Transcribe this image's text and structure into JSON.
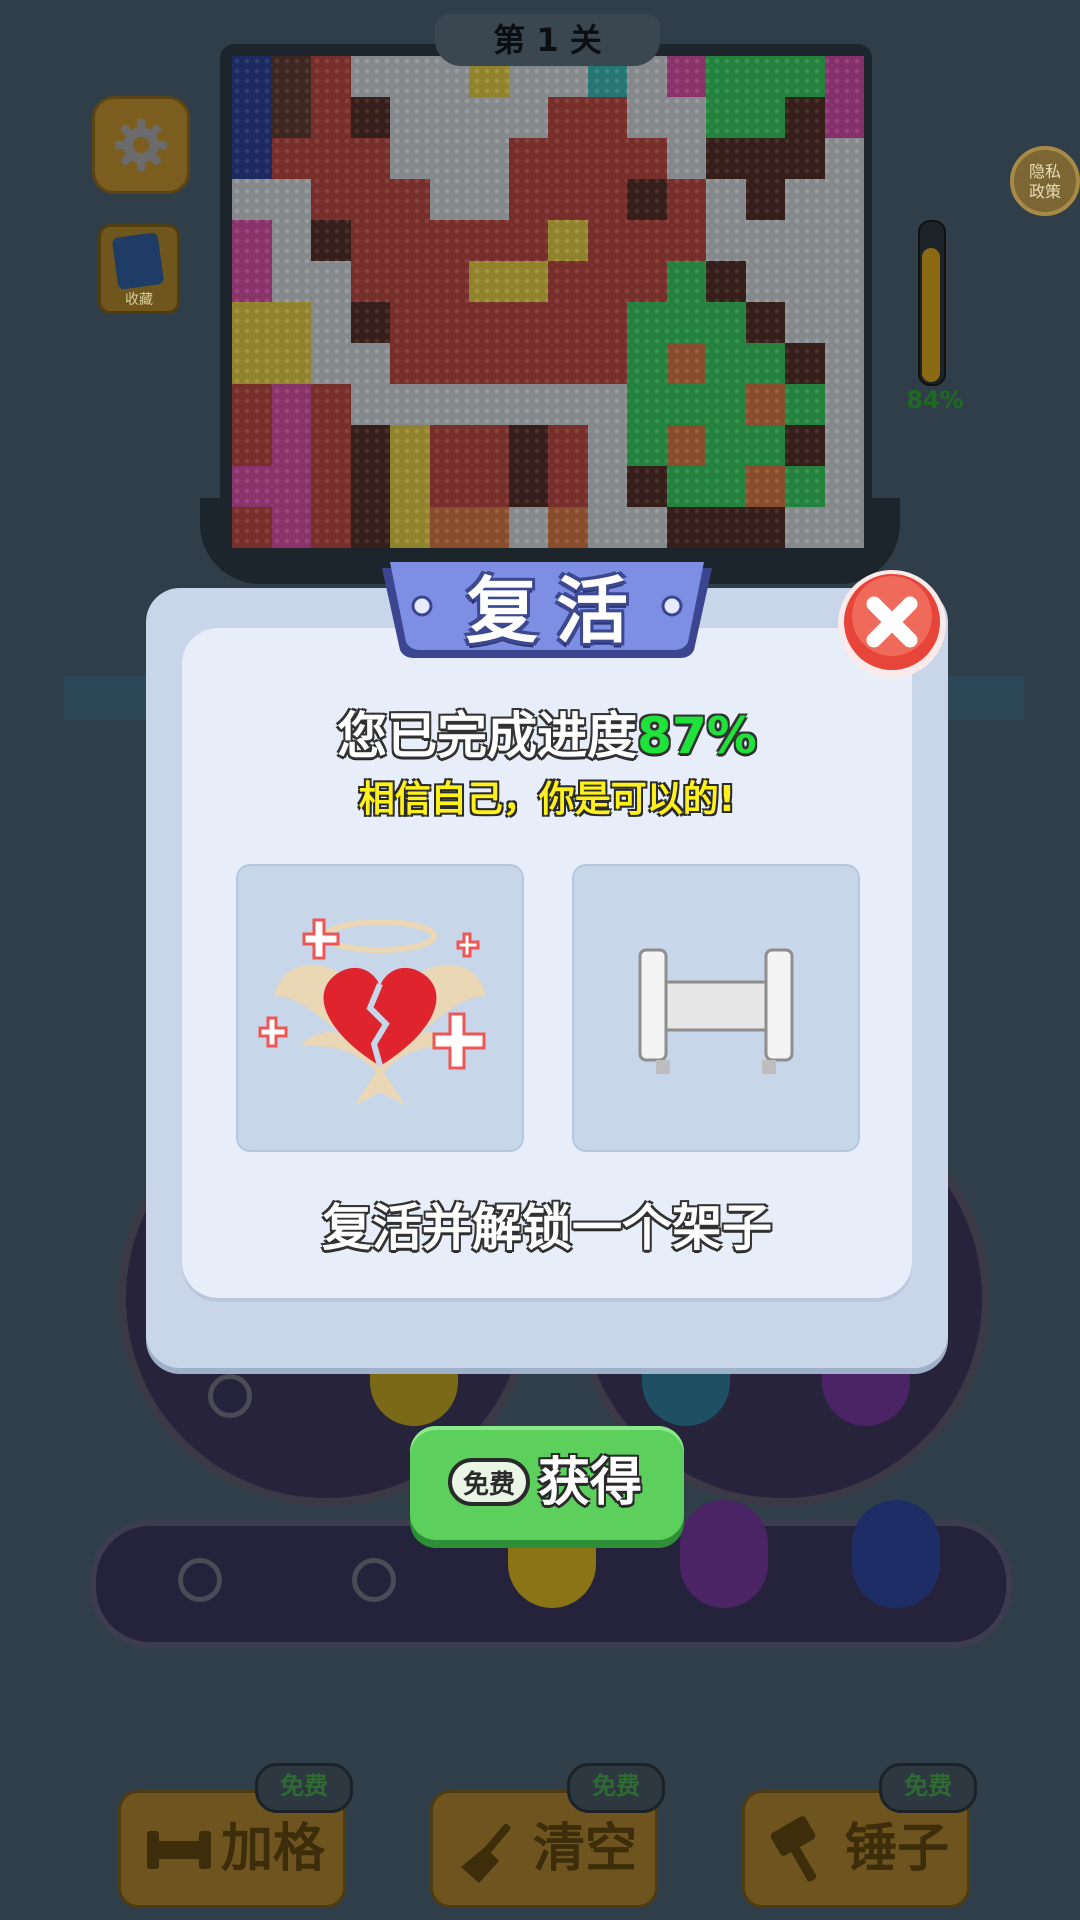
{
  "level": {
    "label": "第 1 关"
  },
  "side": {
    "book_label": "收藏",
    "privacy_label": "隐私\n政策"
  },
  "build_progress": {
    "label": "84%",
    "fraction": 0.84
  },
  "tools": [
    {
      "label": "加格",
      "badge": "免费",
      "icon": "shelf-icon"
    },
    {
      "label": "清空",
      "badge": "免费",
      "icon": "broom-icon"
    },
    {
      "label": "锤子",
      "badge": "免费",
      "icon": "hammer-icon"
    }
  ],
  "dialog": {
    "title": "复活",
    "progress_prefix": "您已完成进度",
    "progress_value": "87%",
    "encourage": "相信自己，你是可以的!",
    "rewards": [
      {
        "icon": "angel-broken-heart-icon"
      },
      {
        "icon": "shelf-rack-icon"
      }
    ],
    "reward_desc": "复活并解锁一个架子",
    "button": {
      "badge": "免费",
      "label": "获得"
    }
  },
  "colors": {
    "accent_green": "#1fe33b",
    "button_green": "#5ccf5d",
    "title_blue": "#6f7fd6",
    "close_red": "#e8453a",
    "encourage_yellow": "#fff21c"
  },
  "pixel_art": [
    [
      "#1c2f8a",
      "#5a2a1a",
      "#c0392b",
      "#dcdcdc",
      "#dcdcdc",
      "#dcdcdc",
      "#f0d030",
      "#dcdcdc",
      "#dcdcdc",
      "#2fb9b0",
      "#dcdcdc",
      "#e23fa0",
      "#2bd04f",
      "#2bd04f",
      "#2bd04f",
      "#d83aa0"
    ],
    [
      "#1c2f8a",
      "#5a2a1a",
      "#c0392b",
      "#4a1a0e",
      "#dcdcdc",
      "#dcdcdc",
      "#dcdcdc",
      "#dcdcdc",
      "#c0392b",
      "#c0392b",
      "#dcdcdc",
      "#dcdcdc",
      "#2bd04f",
      "#2bd04f",
      "#4a1a0e",
      "#d83aa0"
    ],
    [
      "#1c2f8a",
      "#c0392b",
      "#c0392b",
      "#c0392b",
      "#dcdcdc",
      "#dcdcdc",
      "#dcdcdc",
      "#c0392b",
      "#c0392b",
      "#c0392b",
      "#c0392b",
      "#dcdcdc",
      "#4a1a0e",
      "#4a1a0e",
      "#4a1a0e",
      "#dcdcdc"
    ],
    [
      "#dcdcdc",
      "#dcdcdc",
      "#c0392b",
      "#c0392b",
      "#c0392b",
      "#dcdcdc",
      "#dcdcdc",
      "#c0392b",
      "#c0392b",
      "#c0392b",
      "#4a1a0e",
      "#c0392b",
      "#dcdcdc",
      "#4a1a0e",
      "#dcdcdc",
      "#dcdcdc"
    ],
    [
      "#e23fa0",
      "#dcdcdc",
      "#4a1a0e",
      "#c0392b",
      "#c0392b",
      "#c0392b",
      "#c0392b",
      "#c0392b",
      "#f0d030",
      "#c0392b",
      "#c0392b",
      "#c0392b",
      "#dcdcdc",
      "#dcdcdc",
      "#dcdcdc",
      "#dcdcdc"
    ],
    [
      "#e23fa0",
      "#dcdcdc",
      "#dcdcdc",
      "#c0392b",
      "#c0392b",
      "#c0392b",
      "#f0d030",
      "#f0d030",
      "#c0392b",
      "#c0392b",
      "#c0392b",
      "#2bd04f",
      "#4a1a0e",
      "#dcdcdc",
      "#dcdcdc",
      "#dcdcdc"
    ],
    [
      "#f0d030",
      "#f0d030",
      "#dcdcdc",
      "#4a1a0e",
      "#c0392b",
      "#c0392b",
      "#c0392b",
      "#c0392b",
      "#c0392b",
      "#c0392b",
      "#2bd04f",
      "#2bd04f",
      "#2bd04f",
      "#4a1a0e",
      "#dcdcdc",
      "#dcdcdc"
    ],
    [
      "#f0d030",
      "#f0d030",
      "#dcdcdc",
      "#dcdcdc",
      "#c0392b",
      "#c0392b",
      "#c0392b",
      "#c0392b",
      "#c0392b",
      "#c0392b",
      "#2bd04f",
      "#e07030",
      "#2bd04f",
      "#2bd04f",
      "#4a1a0e",
      "#dcdcdc"
    ],
    [
      "#c0392b",
      "#e23fa0",
      "#c0392b",
      "#dcdcdc",
      "#dcdcdc",
      "#dcdcdc",
      "#dcdcdc",
      "#dcdcdc",
      "#dcdcdc",
      "#dcdcdc",
      "#2bd04f",
      "#2bd04f",
      "#2bd04f",
      "#e07030",
      "#2bd04f",
      "#dcdcdc"
    ],
    [
      "#c0392b",
      "#e23fa0",
      "#c0392b",
      "#4a1a0e",
      "#f0d030",
      "#c0392b",
      "#c0392b",
      "#4a1a0e",
      "#c0392b",
      "#dcdcdc",
      "#2bd04f",
      "#e07030",
      "#2bd04f",
      "#2bd04f",
      "#4a1a0e",
      "#dcdcdc"
    ],
    [
      "#e23fa0",
      "#e23fa0",
      "#c0392b",
      "#4a1a0e",
      "#f0d030",
      "#c0392b",
      "#c0392b",
      "#4a1a0e",
      "#c0392b",
      "#dcdcdc",
      "#4a1a0e",
      "#2bd04f",
      "#2bd04f",
      "#e07030",
      "#2bd04f",
      "#dcdcdc"
    ],
    [
      "#c0392b",
      "#e23fa0",
      "#c0392b",
      "#4a1a0e",
      "#f0d030",
      "#e07030",
      "#e07030",
      "#dcdcdc",
      "#e07030",
      "#dcdcdc",
      "#dcdcdc",
      "#4a1a0e",
      "#4a1a0e",
      "#4a1a0e",
      "#dcdcdc",
      "#dcdcdc"
    ]
  ]
}
